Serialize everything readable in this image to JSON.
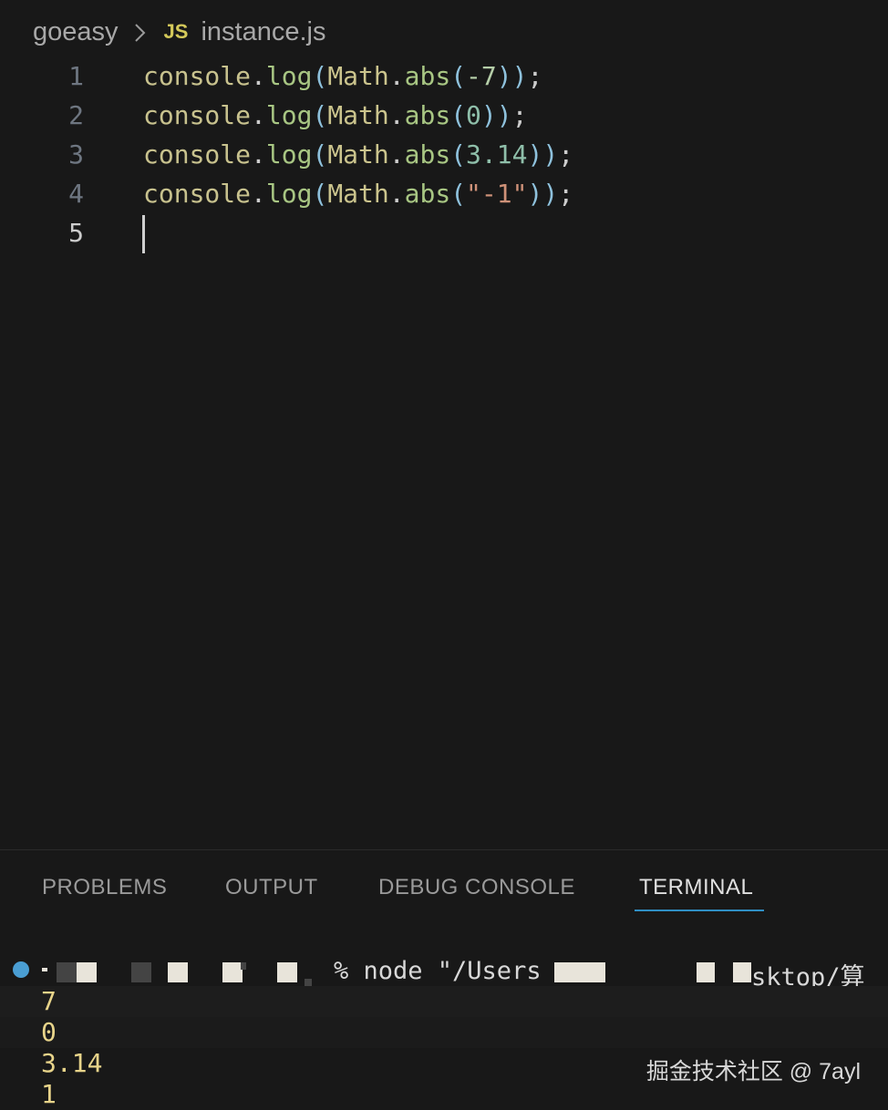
{
  "breadcrumb": {
    "folder": "goeasy",
    "file_icon": "JS",
    "file_name": "instance.js"
  },
  "editor": {
    "lines": [
      {
        "number": "1",
        "code": "console.log(Math.abs(-7));"
      },
      {
        "number": "2",
        "code": "console.log(Math.abs(0));"
      },
      {
        "number": "3",
        "code": "console.log(Math.abs(3.14));"
      },
      {
        "number": "4",
        "code": "console.log(Math.abs(\"-1\"));"
      },
      {
        "number": "5",
        "code": ""
      }
    ],
    "tokens": {
      "console": "console",
      "dot": ".",
      "log": "log",
      "math": "Math",
      "abs": "abs",
      "open": "(",
      "close": ")",
      "semi": ";",
      "arg1": "-7",
      "arg2": "0",
      "arg3": "3.14",
      "arg4": "\"-1\""
    },
    "active_line": "5"
  },
  "panel": {
    "tabs": [
      {
        "label": "PROBLEMS"
      },
      {
        "label": "OUTPUT"
      },
      {
        "label": "DEBUG CONSOLE"
      },
      {
        "label": "TERMINAL"
      }
    ],
    "active_tab": "TERMINAL"
  },
  "terminal": {
    "prompt_text": "% node \"/Users",
    "path_tail": "sktop/算",
    "outputs": [
      "7",
      "0",
      "3.14",
      "1"
    ]
  },
  "watermark": "掘金技术社区 @ 7ayl",
  "colors": {
    "background": "#181818",
    "accent": "#2f8fc5",
    "terminal_output": "#e8d48a",
    "js_icon": "#d4c95a"
  }
}
